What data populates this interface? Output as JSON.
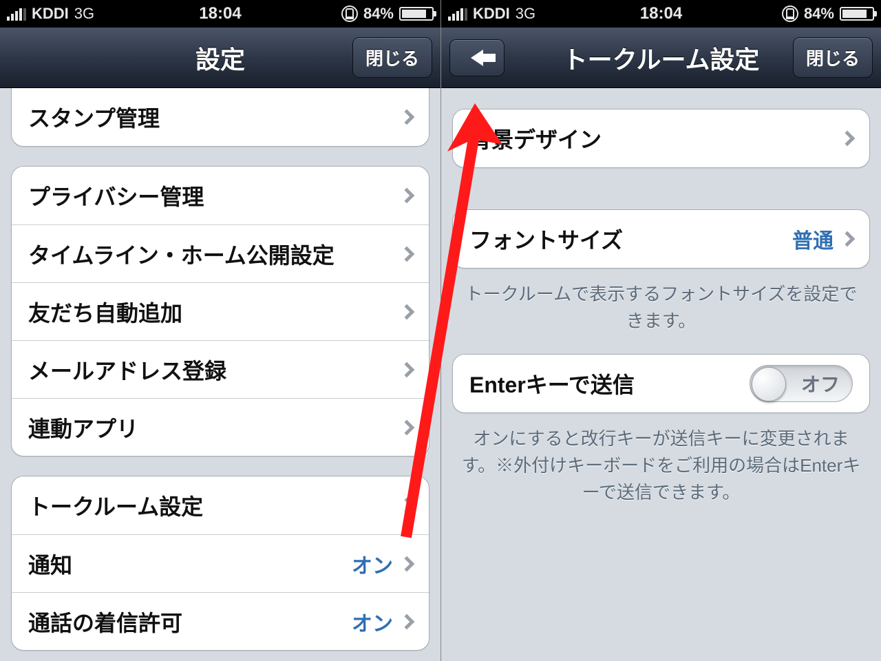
{
  "status": {
    "carrier": "KDDI",
    "network": "3G",
    "time": "18:04",
    "battery_pct": "84%"
  },
  "left": {
    "title": "設定",
    "close": "閉じる",
    "group1": [
      {
        "label": "スタンプ管理"
      }
    ],
    "group2": [
      {
        "label": "プライバシー管理"
      },
      {
        "label": "タイムライン・ホーム公開設定"
      },
      {
        "label": "友だち自動追加"
      },
      {
        "label": "メールアドレス登録"
      },
      {
        "label": "連動アプリ"
      }
    ],
    "group3": [
      {
        "label": "トークルーム設定"
      },
      {
        "label": "通知",
        "value": "オン"
      },
      {
        "label": "通話の着信許可",
        "value": "オン"
      }
    ]
  },
  "right": {
    "title": "トークルーム設定",
    "close": "閉じる",
    "group1": [
      {
        "label": "背景デザイン"
      }
    ],
    "group2": [
      {
        "label": "フォントサイズ",
        "value": "普通"
      }
    ],
    "footer2": "トークルームで表示するフォントサイズを設定できます。",
    "group3": [
      {
        "label": "Enterキーで送信",
        "toggle": "オフ"
      }
    ],
    "footer3": "オンにすると改行キーが送信キーに変更されます。※外付けキーボードをご利用の場合はEnterキーで送信できます。"
  }
}
